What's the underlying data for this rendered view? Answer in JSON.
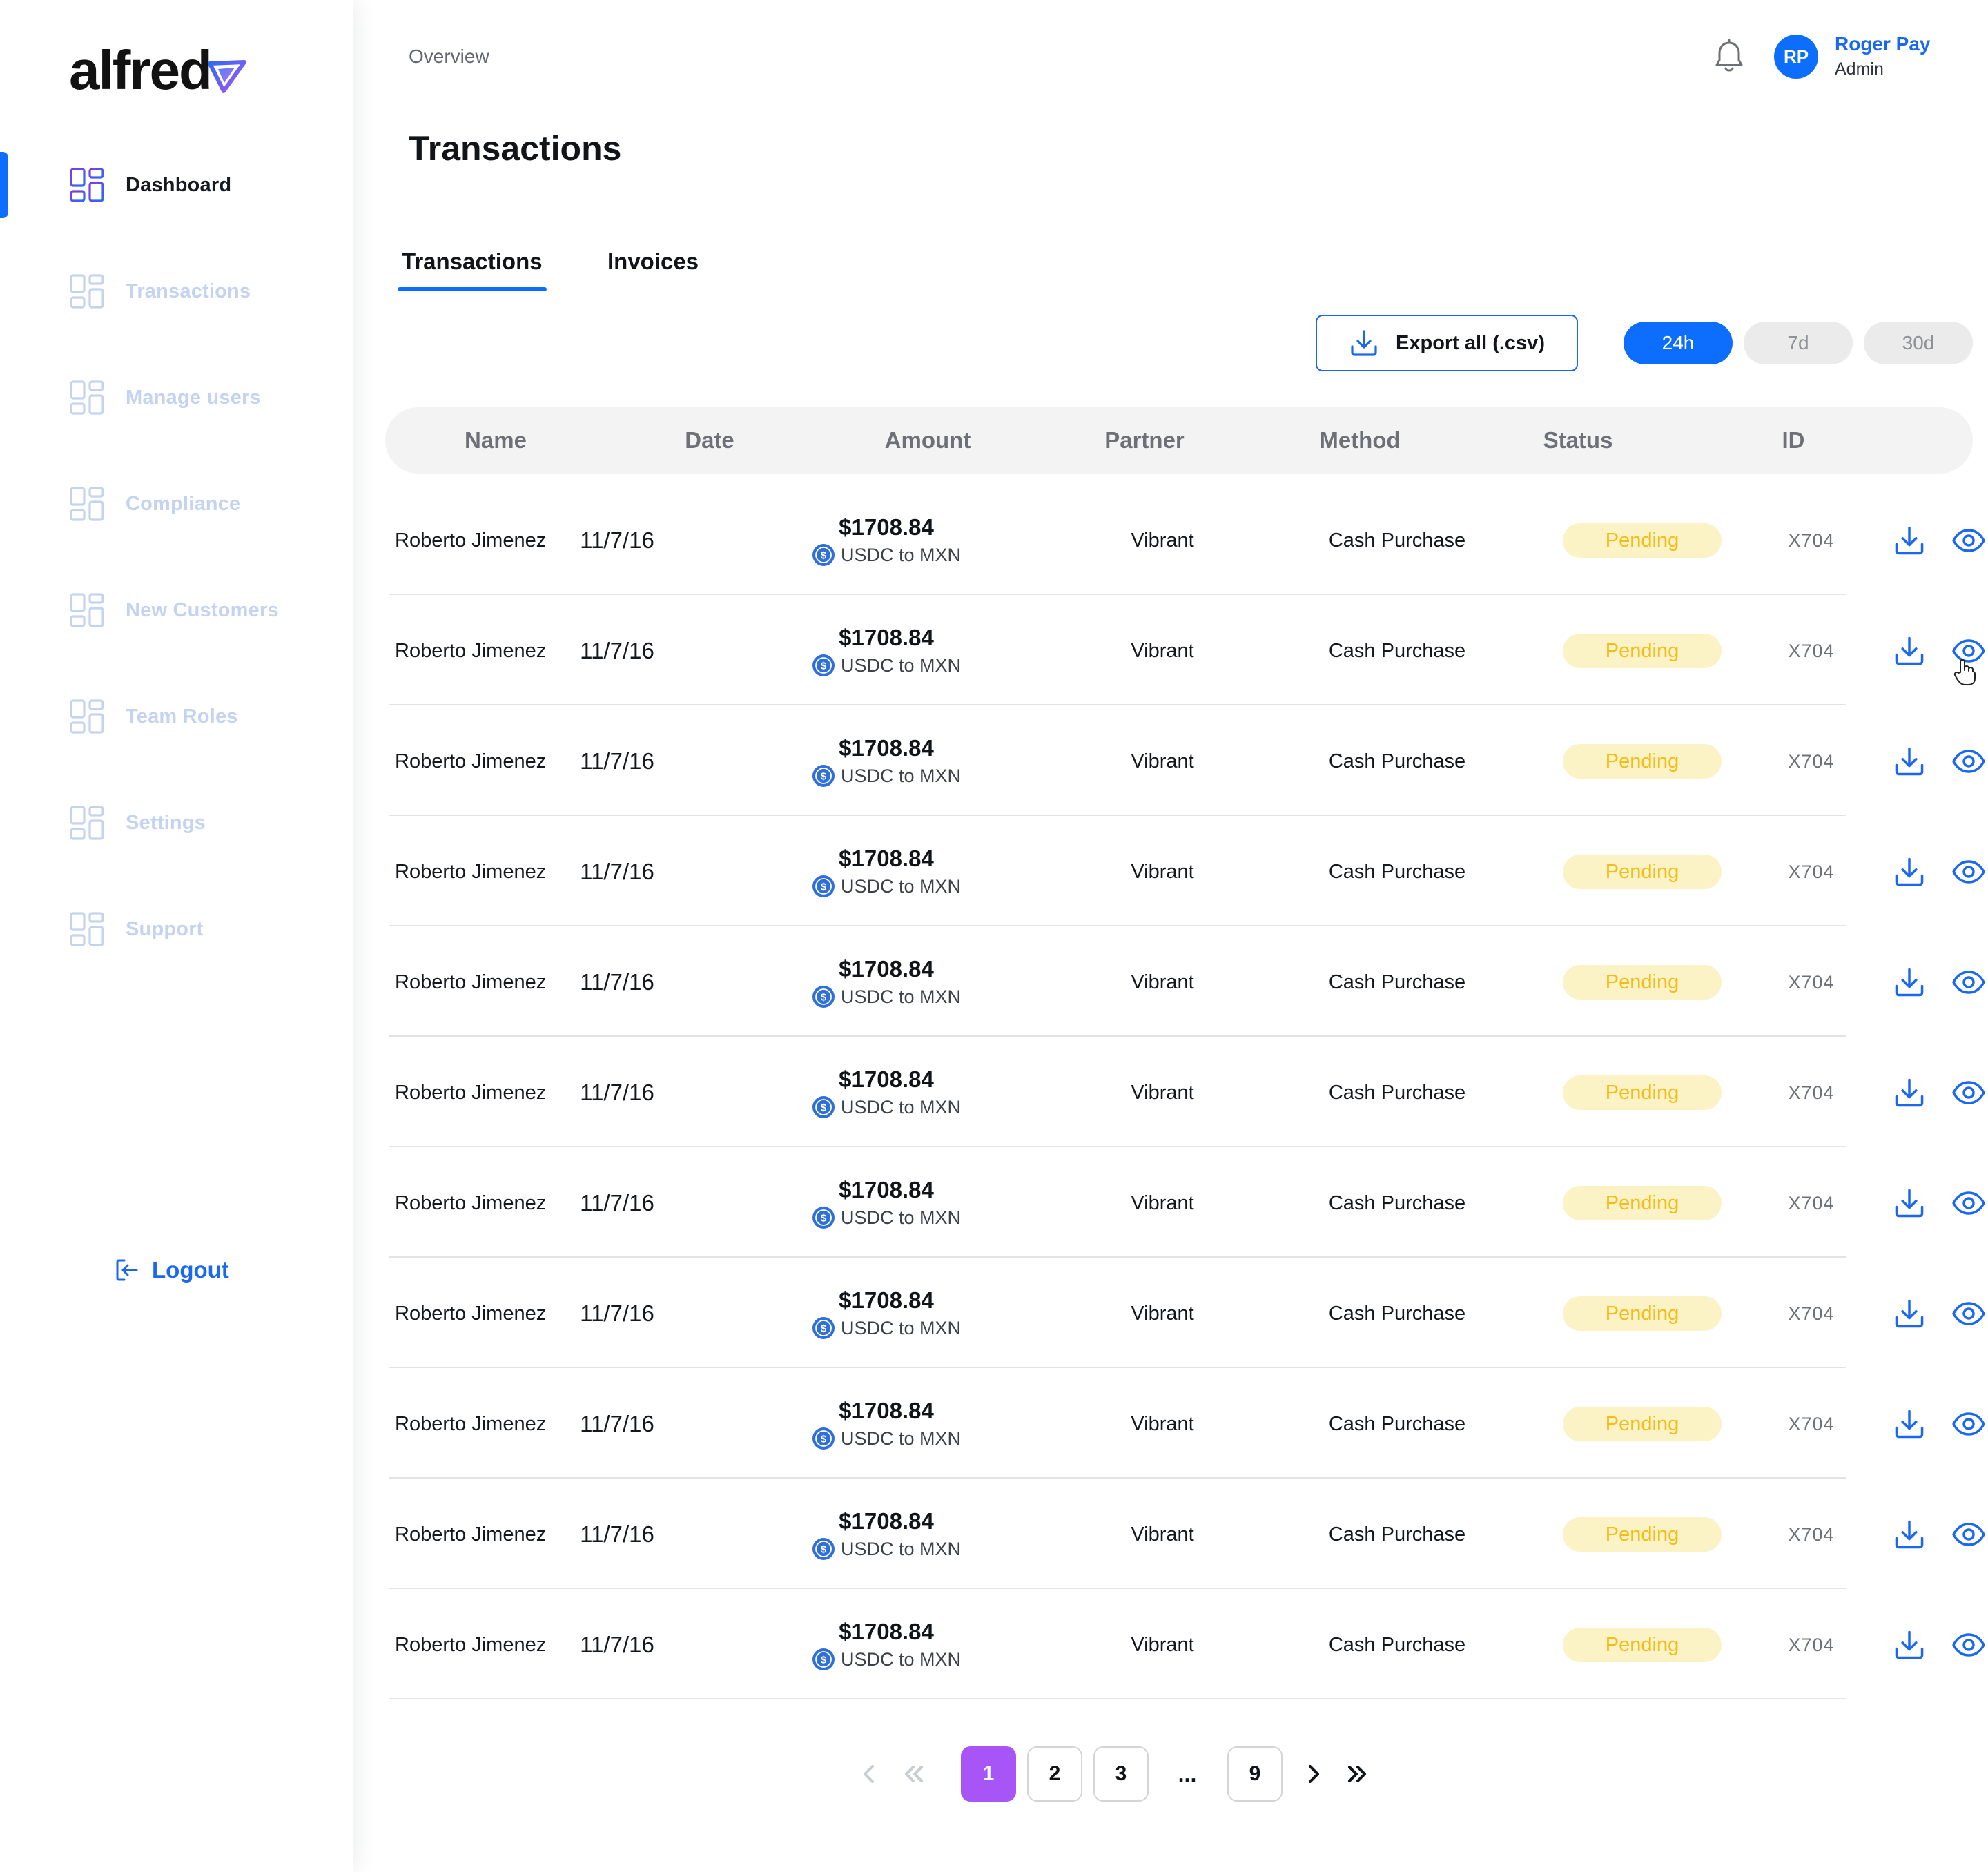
{
  "brand": {
    "name": "alfred"
  },
  "sidebar": {
    "items": [
      {
        "label": "Dashboard",
        "active": true
      },
      {
        "label": "Transactions",
        "active": false
      },
      {
        "label": "Manage users",
        "active": false
      },
      {
        "label": "Compliance",
        "active": false
      },
      {
        "label": "New Customers",
        "active": false
      },
      {
        "label": "Team Roles",
        "active": false
      },
      {
        "label": "Settings",
        "active": false
      },
      {
        "label": "Support",
        "active": false
      }
    ],
    "logout_label": "Logout"
  },
  "header": {
    "breadcrumb": "Overview",
    "title": "Transactions",
    "user": {
      "initials": "RP",
      "name": "Roger Pay",
      "role": "Admin"
    }
  },
  "tabs": [
    {
      "label": "Transactions",
      "active": true
    },
    {
      "label": "Invoices",
      "active": false
    }
  ],
  "toolbar": {
    "export_label": "Export all (.csv)",
    "ranges": [
      {
        "label": "24h",
        "active": true
      },
      {
        "label": "7d",
        "active": false
      },
      {
        "label": "30d",
        "active": false
      }
    ]
  },
  "table": {
    "columns": [
      "Name",
      "Date",
      "Amount",
      "Partner",
      "Method",
      "Status",
      "ID"
    ],
    "rows": [
      {
        "name": "Roberto Jimenez",
        "date": "11/7/16",
        "amount": "$1708.84",
        "pair": "USDC to MXN",
        "partner": "Vibrant",
        "method": "Cash Purchase",
        "status": "Pending",
        "id": "X704"
      },
      {
        "name": "Roberto Jimenez",
        "date": "11/7/16",
        "amount": "$1708.84",
        "pair": "USDC to MXN",
        "partner": "Vibrant",
        "method": "Cash Purchase",
        "status": "Pending",
        "id": "X704"
      },
      {
        "name": "Roberto Jimenez",
        "date": "11/7/16",
        "amount": "$1708.84",
        "pair": "USDC to MXN",
        "partner": "Vibrant",
        "method": "Cash Purchase",
        "status": "Pending",
        "id": "X704"
      },
      {
        "name": "Roberto Jimenez",
        "date": "11/7/16",
        "amount": "$1708.84",
        "pair": "USDC to MXN",
        "partner": "Vibrant",
        "method": "Cash Purchase",
        "status": "Pending",
        "id": "X704"
      },
      {
        "name": "Roberto Jimenez",
        "date": "11/7/16",
        "amount": "$1708.84",
        "pair": "USDC to MXN",
        "partner": "Vibrant",
        "method": "Cash Purchase",
        "status": "Pending",
        "id": "X704"
      },
      {
        "name": "Roberto Jimenez",
        "date": "11/7/16",
        "amount": "$1708.84",
        "pair": "USDC to MXN",
        "partner": "Vibrant",
        "method": "Cash Purchase",
        "status": "Pending",
        "id": "X704"
      },
      {
        "name": "Roberto Jimenez",
        "date": "11/7/16",
        "amount": "$1708.84",
        "pair": "USDC to MXN",
        "partner": "Vibrant",
        "method": "Cash Purchase",
        "status": "Pending",
        "id": "X704"
      },
      {
        "name": "Roberto Jimenez",
        "date": "11/7/16",
        "amount": "$1708.84",
        "pair": "USDC to MXN",
        "partner": "Vibrant",
        "method": "Cash Purchase",
        "status": "Pending",
        "id": "X704"
      },
      {
        "name": "Roberto Jimenez",
        "date": "11/7/16",
        "amount": "$1708.84",
        "pair": "USDC to MXN",
        "partner": "Vibrant",
        "method": "Cash Purchase",
        "status": "Pending",
        "id": "X704"
      },
      {
        "name": "Roberto Jimenez",
        "date": "11/7/16",
        "amount": "$1708.84",
        "pair": "USDC to MXN",
        "partner": "Vibrant",
        "method": "Cash Purchase",
        "status": "Pending",
        "id": "X704"
      },
      {
        "name": "Roberto Jimenez",
        "date": "11/7/16",
        "amount": "$1708.84",
        "pair": "USDC to MXN",
        "partner": "Vibrant",
        "method": "Cash Purchase",
        "status": "Pending",
        "id": "X704"
      }
    ]
  },
  "pagination": {
    "pages": [
      "1",
      "2",
      "3",
      "...",
      "9"
    ],
    "current": "1"
  },
  "colors": {
    "accent": "#0d6efd",
    "link": "#1a67f0",
    "pending_bg": "#fbf3c5",
    "pending_text": "#f3bc18",
    "page_active": "#a855f7",
    "sidebar_inactive": "#c4d3f0"
  },
  "icons": {
    "nav": "grid-icon",
    "logout": "logout-icon",
    "notifications": "bell-icon",
    "export": "download-icon",
    "row_download": "download-icon",
    "row_view": "eye-icon",
    "currency": "usdc-coin-icon"
  }
}
